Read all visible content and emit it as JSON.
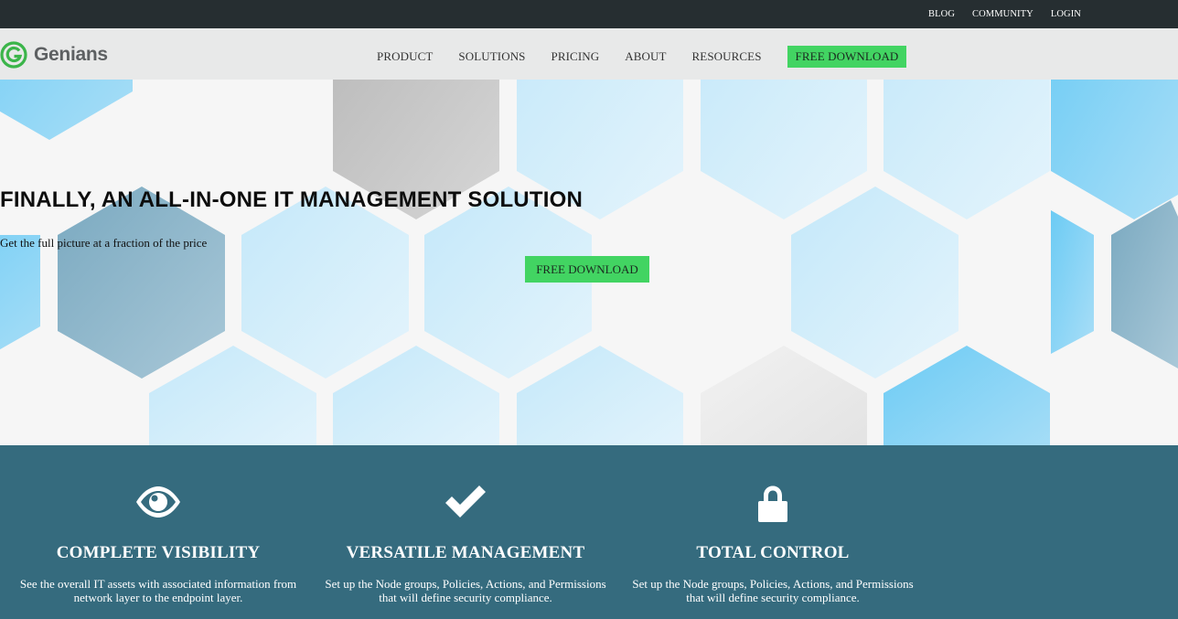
{
  "topbar": {
    "links": [
      {
        "label": "BLOG"
      },
      {
        "label": "COMMUNITY"
      },
      {
        "label": "LOGIN"
      }
    ]
  },
  "brand": {
    "name": "Genians",
    "icon": "genians-logo-icon",
    "logo_color": "#3bb54a"
  },
  "nav": {
    "items": [
      {
        "label": "PRODUCT"
      },
      {
        "label": "SOLUTIONS"
      },
      {
        "label": "PRICING"
      },
      {
        "label": "ABOUT"
      },
      {
        "label": "RESOURCES"
      }
    ],
    "cta_label": "FREE DOWNLOAD"
  },
  "hero": {
    "title": "FINALLY, AN ALL-IN-ONE IT MANAGEMENT SOLUTION",
    "subtitle": "Get the full picture at a fraction of the price",
    "button_label": "FREE DOWNLOAD"
  },
  "features": [
    {
      "icon": "eye-icon",
      "title": "COMPLETE VISIBILITY",
      "desc_line1": "See the overall IT assets with associated information from",
      "desc_line2": "network layer to the endpoint layer."
    },
    {
      "icon": "checkmark-icon",
      "title": "VERSATILE MANAGEMENT",
      "desc_line1": "Set up the Node groups, Policies, Actions, and Permissions",
      "desc_line2": "that will define security compliance."
    },
    {
      "icon": "lock-icon",
      "title": "TOTAL CONTROL",
      "desc_line1": "Set up the Node groups, Policies, Actions, and Permissions",
      "desc_line2": "that will define security compliance."
    }
  ],
  "colors": {
    "topbar": "#262e31",
    "navbar": "#e8e9e9",
    "accent_green": "#42d462",
    "features_bg": "#356b7e"
  }
}
